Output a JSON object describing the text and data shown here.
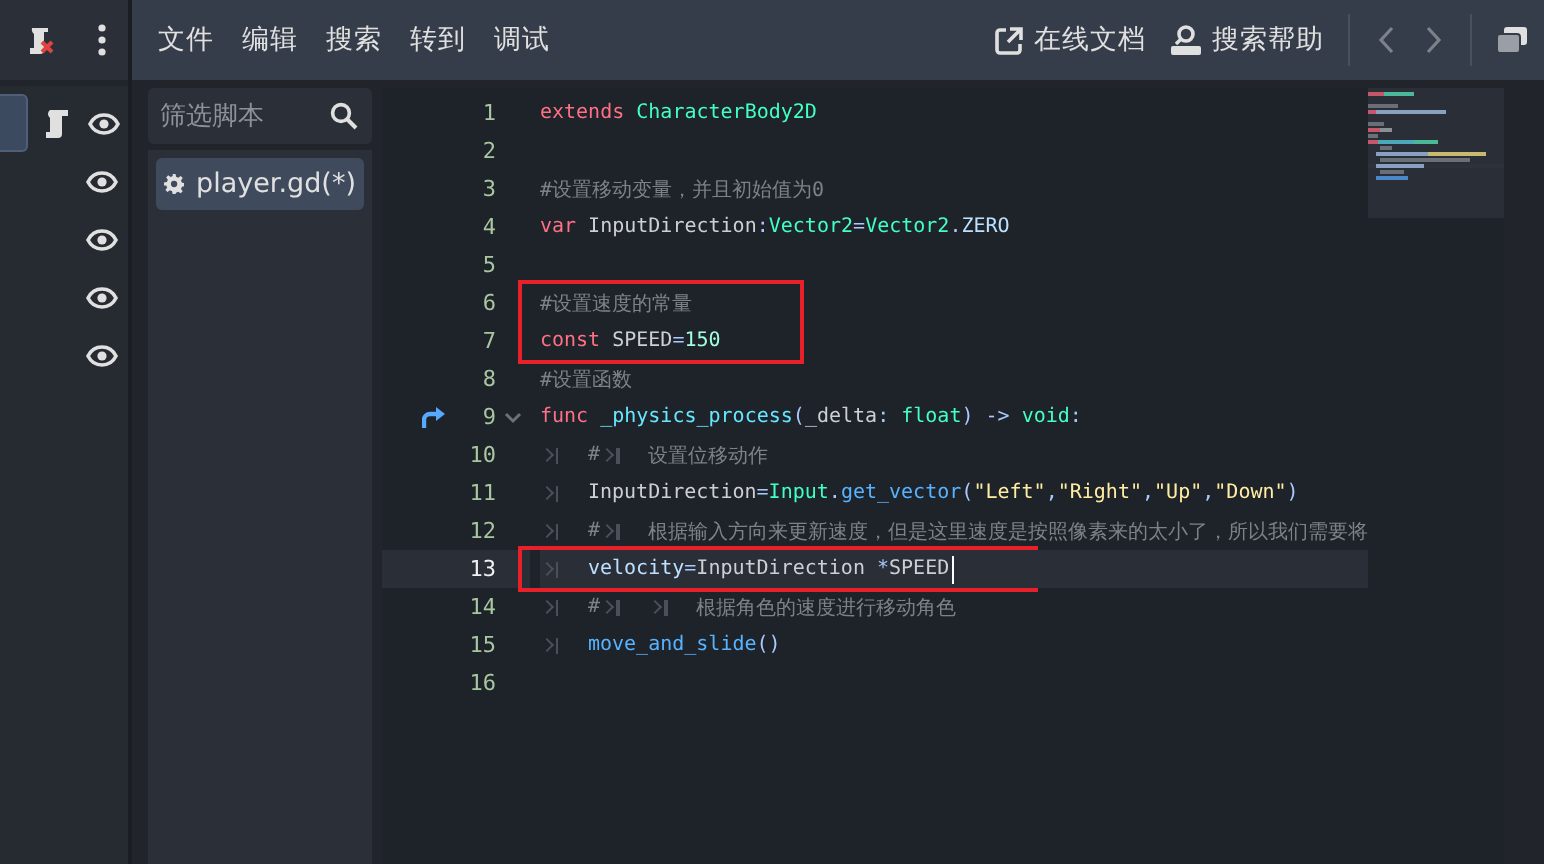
{
  "dock": {
    "rows": [
      {
        "selected": true,
        "script": true,
        "visible": true
      },
      {
        "selected": false,
        "script": false,
        "visible": true
      },
      {
        "selected": false,
        "script": false,
        "visible": true
      },
      {
        "selected": false,
        "script": false,
        "visible": true
      },
      {
        "selected": false,
        "script": false,
        "visible": true
      }
    ]
  },
  "menu": [
    "文件",
    "编辑",
    "搜索",
    "转到",
    "调试"
  ],
  "toolbar": {
    "online_docs": "在线文档",
    "search_help": "搜索帮助"
  },
  "script_list": {
    "filter": {
      "placeholder": "筛选脚本"
    },
    "items": [
      {
        "label": "player.gd(*)",
        "selected": true
      }
    ]
  },
  "editor": {
    "lines": [
      {
        "number": "1",
        "current": false,
        "boxed": false,
        "fold": false,
        "override": false,
        "tokens": [
          {
            "kind": "keyword",
            "text": "extends "
          },
          {
            "kind": "type",
            "text": "CharacterBody2D"
          }
        ]
      },
      {
        "number": "2",
        "current": false,
        "boxed": false,
        "fold": false,
        "override": false
      },
      {
        "number": "3",
        "current": false,
        "boxed": false,
        "fold": false,
        "override": false,
        "tokens": [
          {
            "kind": "comment",
            "text": "#设置移动变量，并且初始值为0"
          }
        ]
      },
      {
        "number": "4",
        "current": false,
        "boxed": false,
        "fold": false,
        "override": false,
        "tokens": [
          {
            "kind": "keyword",
            "text": "var"
          },
          {
            "kind": "plain",
            "text": " InputDirection"
          },
          {
            "kind": "symbol",
            "text": ":"
          },
          {
            "kind": "type",
            "text": "Vector2"
          },
          {
            "kind": "symbol",
            "text": "="
          },
          {
            "kind": "type",
            "text": "Vector2"
          },
          {
            "kind": "symbol",
            "text": "."
          },
          {
            "kind": "member",
            "text": "ZERO"
          }
        ]
      },
      {
        "number": "5",
        "current": false,
        "boxed": false,
        "fold": false,
        "override": false
      },
      {
        "number": "6",
        "current": false,
        "boxed": true,
        "fold": false,
        "override": false,
        "tokens": [
          {
            "kind": "comment",
            "text": "#设置速度的常量"
          }
        ]
      },
      {
        "number": "7",
        "current": false,
        "boxed": true,
        "fold": false,
        "override": false,
        "tokens": [
          {
            "kind": "keyword",
            "text": "const"
          },
          {
            "kind": "plain",
            "text": " SPEED"
          },
          {
            "kind": "symbol",
            "text": "="
          },
          {
            "kind": "number",
            "text": "150"
          }
        ]
      },
      {
        "number": "8",
        "current": false,
        "boxed": false,
        "fold": false,
        "override": false,
        "tokens": [
          {
            "kind": "comment",
            "text": "#设置函数"
          }
        ]
      },
      {
        "number": "9",
        "current": false,
        "boxed": false,
        "fold": true,
        "override": true,
        "tokens": [
          {
            "kind": "keyword",
            "text": "func "
          },
          {
            "kind": "funcname",
            "text": "_physics_process"
          },
          {
            "kind": "symbol",
            "text": "("
          },
          {
            "kind": "plain",
            "text": "_delta"
          },
          {
            "kind": "symbol",
            "text": ": "
          },
          {
            "kind": "type",
            "text": "float"
          },
          {
            "kind": "symbol",
            "text": ") -> "
          },
          {
            "kind": "type",
            "text": "void"
          },
          {
            "kind": "symbol",
            "text": ":"
          }
        ]
      },
      {
        "number": "10",
        "current": false,
        "boxed": false,
        "fold": false,
        "override": false,
        "tokens": [
          {
            "kind": "tab"
          },
          {
            "kind": "comment",
            "text": "#"
          },
          {
            "kind": "tab"
          },
          {
            "kind": "comment",
            "text": "设置位移动作"
          }
        ]
      },
      {
        "number": "11",
        "current": false,
        "boxed": false,
        "fold": false,
        "override": false,
        "tokens": [
          {
            "kind": "tab"
          },
          {
            "kind": "plain",
            "text": "InputDirection"
          },
          {
            "kind": "symbol",
            "text": "="
          },
          {
            "kind": "type",
            "text": "Input"
          },
          {
            "kind": "symbol",
            "text": "."
          },
          {
            "kind": "call",
            "text": "get_vector"
          },
          {
            "kind": "symbol",
            "text": "("
          },
          {
            "kind": "string",
            "text": "\"Left\""
          },
          {
            "kind": "symbol",
            "text": ","
          },
          {
            "kind": "string",
            "text": "\"Right\""
          },
          {
            "kind": "symbol",
            "text": ","
          },
          {
            "kind": "string",
            "text": "\"Up\""
          },
          {
            "kind": "symbol",
            "text": ","
          },
          {
            "kind": "string",
            "text": "\"Down\""
          },
          {
            "kind": "symbol",
            "text": ")"
          }
        ]
      },
      {
        "number": "12",
        "current": false,
        "boxed": false,
        "fold": false,
        "override": false,
        "tokens": [
          {
            "kind": "tab"
          },
          {
            "kind": "comment",
            "text": "#"
          },
          {
            "kind": "tab"
          },
          {
            "kind": "comment",
            "text": "根据输入方向来更新速度，但是这里速度是按照像素来的太小了，所以我们需要将"
          }
        ]
      },
      {
        "number": "13",
        "current": true,
        "boxed": true,
        "fold": false,
        "override": false,
        "tokens": [
          {
            "kind": "tab"
          },
          {
            "kind": "member",
            "text": "velocity"
          },
          {
            "kind": "symbol",
            "text": "="
          },
          {
            "kind": "plain",
            "text": "InputDirection "
          },
          {
            "kind": "symbol",
            "text": "*"
          },
          {
            "kind": "plain",
            "text": "SPEED"
          }
        ]
      },
      {
        "number": "14",
        "current": false,
        "boxed": false,
        "fold": false,
        "override": false,
        "tokens": [
          {
            "kind": "tab"
          },
          {
            "kind": "comment",
            "text": "#"
          },
          {
            "kind": "tab"
          },
          {
            "kind": "tab"
          },
          {
            "kind": "comment",
            "text": "根据角色的速度进行移动角色"
          }
        ]
      },
      {
        "number": "15",
        "current": false,
        "boxed": false,
        "fold": false,
        "override": false,
        "tokens": [
          {
            "kind": "tab"
          },
          {
            "kind": "call",
            "text": "move_and_slide"
          },
          {
            "kind": "symbol",
            "text": "()"
          }
        ]
      },
      {
        "number": "16",
        "current": false,
        "boxed": false,
        "fold": false,
        "override": false
      }
    ]
  }
}
